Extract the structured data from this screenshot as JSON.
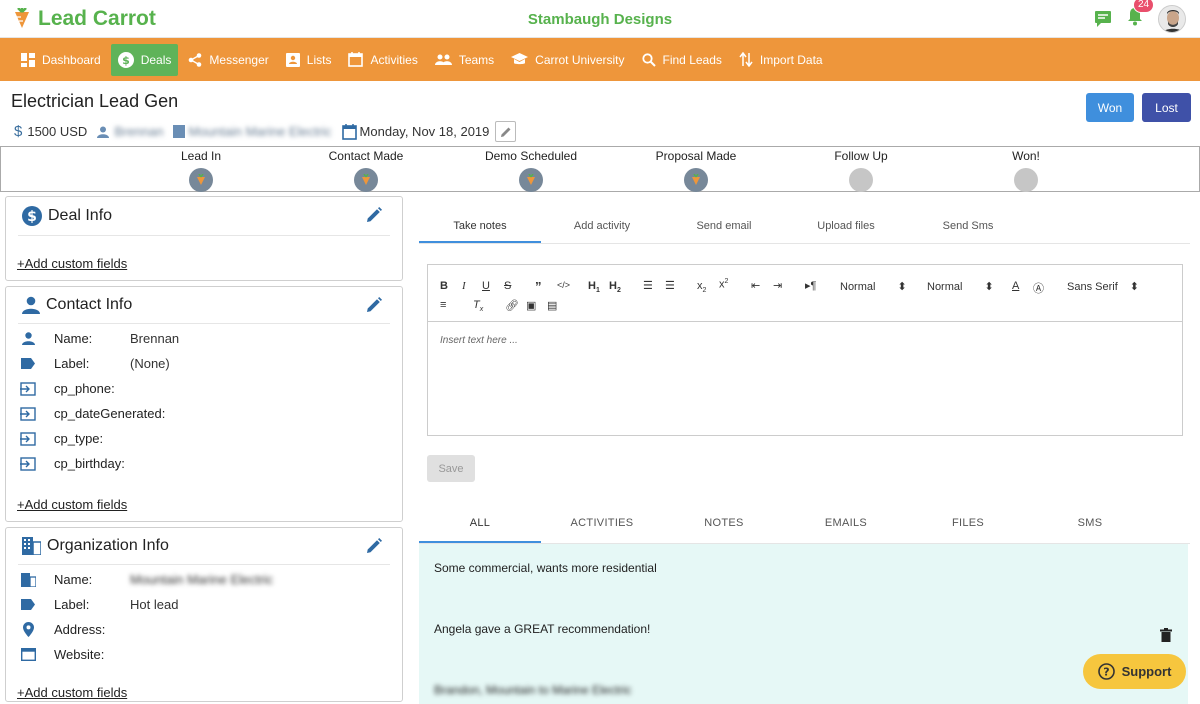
{
  "app": {
    "name": "Lead Carrot",
    "company": "Stambaugh Designs",
    "notification_count": "24"
  },
  "nav": [
    {
      "label": "Dashboard",
      "icon": "dashboard-icon"
    },
    {
      "label": "Deals",
      "icon": "dollar-icon"
    },
    {
      "label": "Messenger",
      "icon": "share-icon"
    },
    {
      "label": "Lists",
      "icon": "contact-card-icon"
    },
    {
      "label": "Activities",
      "icon": "calendar-icon"
    },
    {
      "label": "Teams",
      "icon": "people-icon"
    },
    {
      "label": "Carrot University",
      "icon": "school-icon"
    },
    {
      "label": "Find Leads",
      "icon": "search-icon"
    },
    {
      "label": "Import Data",
      "icon": "import-icon"
    }
  ],
  "deal": {
    "title": "Electrician Lead Gen",
    "amount": "1500 USD",
    "person": "Brennan",
    "organization": "Mountain Marine Electric",
    "date": "Monday, Nov 18, 2019",
    "won_label": "Won",
    "lost_label": "Lost"
  },
  "stages": [
    {
      "label": "Lead In",
      "done": true
    },
    {
      "label": "Contact Made",
      "done": true
    },
    {
      "label": "Demo Scheduled",
      "done": true
    },
    {
      "label": "Proposal Made",
      "done": true
    },
    {
      "label": "Follow Up",
      "done": false
    },
    {
      "label": "Won!",
      "done": false
    }
  ],
  "deal_info": {
    "title": "Deal Info",
    "add_link": "+Add custom fields"
  },
  "contact_info": {
    "title": "Contact Info",
    "fields": [
      {
        "label": "Name:",
        "value": "Brennan"
      },
      {
        "label": "Label:",
        "value": "(None)"
      },
      {
        "label": "cp_phone:",
        "value": ""
      },
      {
        "label": "cp_dateGenerated:",
        "value": ""
      },
      {
        "label": "cp_type:",
        "value": ""
      },
      {
        "label": "cp_birthday:",
        "value": ""
      }
    ],
    "add_link": "+Add custom fields"
  },
  "org_info": {
    "title": "Organization Info",
    "fields": [
      {
        "label": "Name:",
        "value": "Mountain Marine Electric"
      },
      {
        "label": "Label:",
        "value": "Hot lead"
      },
      {
        "label": "Address:",
        "value": ""
      },
      {
        "label": "Website:",
        "value": ""
      }
    ],
    "add_link": "+Add custom fields"
  },
  "action_tabs": [
    "Take notes",
    "Add activity",
    "Send email",
    "Upload files",
    "Send Sms"
  ],
  "editor": {
    "placeholder": "Insert text here ...",
    "size1": "Normal",
    "size2": "Normal",
    "font": "Sans Serif",
    "save_label": "Save"
  },
  "history_tabs": [
    "ALL",
    "ACTIVITIES",
    "NOTES",
    "EMAILS",
    "FILES",
    "SMS"
  ],
  "feed": [
    "Some commercial, wants more residential",
    "Angela gave a GREAT recommendation!",
    "Brandon, Mountain to Marine Electric"
  ],
  "support_label": "Support",
  "colors": {
    "brand_green": "#57b24d",
    "nav_orange": "#ee963b",
    "won_blue": "#3f8fdd",
    "lost_blue": "#3f51a8",
    "feed_bg": "#e6f8f6"
  }
}
